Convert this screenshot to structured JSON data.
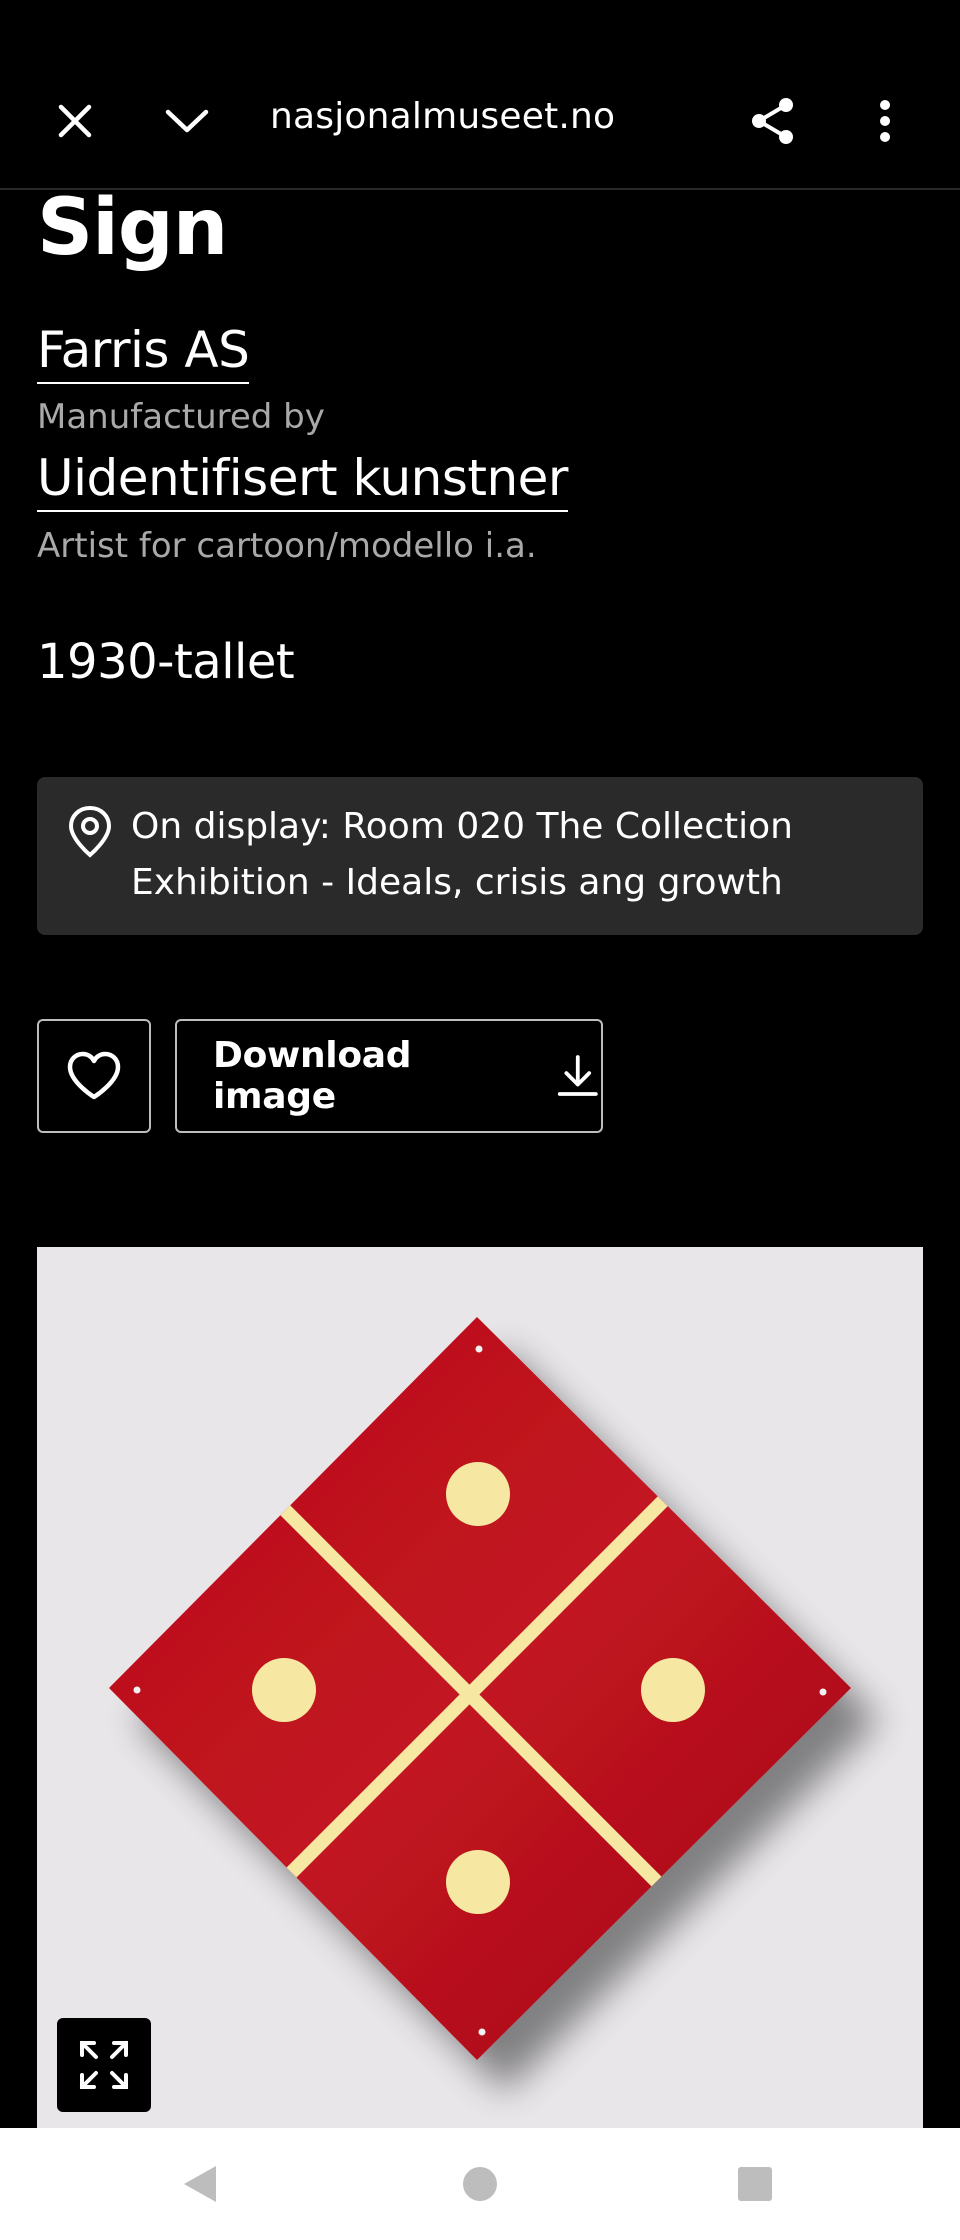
{
  "browser": {
    "url": "nasjonalmuseet.no",
    "icons": {
      "close": "close-icon",
      "minimize": "chevron-down-icon",
      "share": "share-icon",
      "more": "more-vertical-icon"
    }
  },
  "artwork": {
    "title": "Sign",
    "makers": [
      {
        "name": "Farris AS",
        "role": "Manufactured by"
      },
      {
        "name": "Uidentifisert kunstner",
        "role": "Artist for cartoon/modello i.a."
      }
    ],
    "date": "1930-tallet",
    "display": {
      "text": "On display: Room 020 The Collection Exhibition - Ideals, crisis ang growth",
      "icon": "location-pin-icon"
    }
  },
  "actions": {
    "favorite_icon": "heart-icon",
    "download_label": "Download image",
    "download_icon": "download-icon"
  },
  "image_viewer": {
    "expand_icon": "expand-icon",
    "colors": {
      "background": "#e8e6e9",
      "sign_red": "#b5121b",
      "sign_yellow": "#f6e7a2"
    }
  },
  "system_nav": {
    "back_icon": "back-triangle-icon",
    "home_icon": "home-circle-icon",
    "recents_icon": "recents-square-icon"
  }
}
